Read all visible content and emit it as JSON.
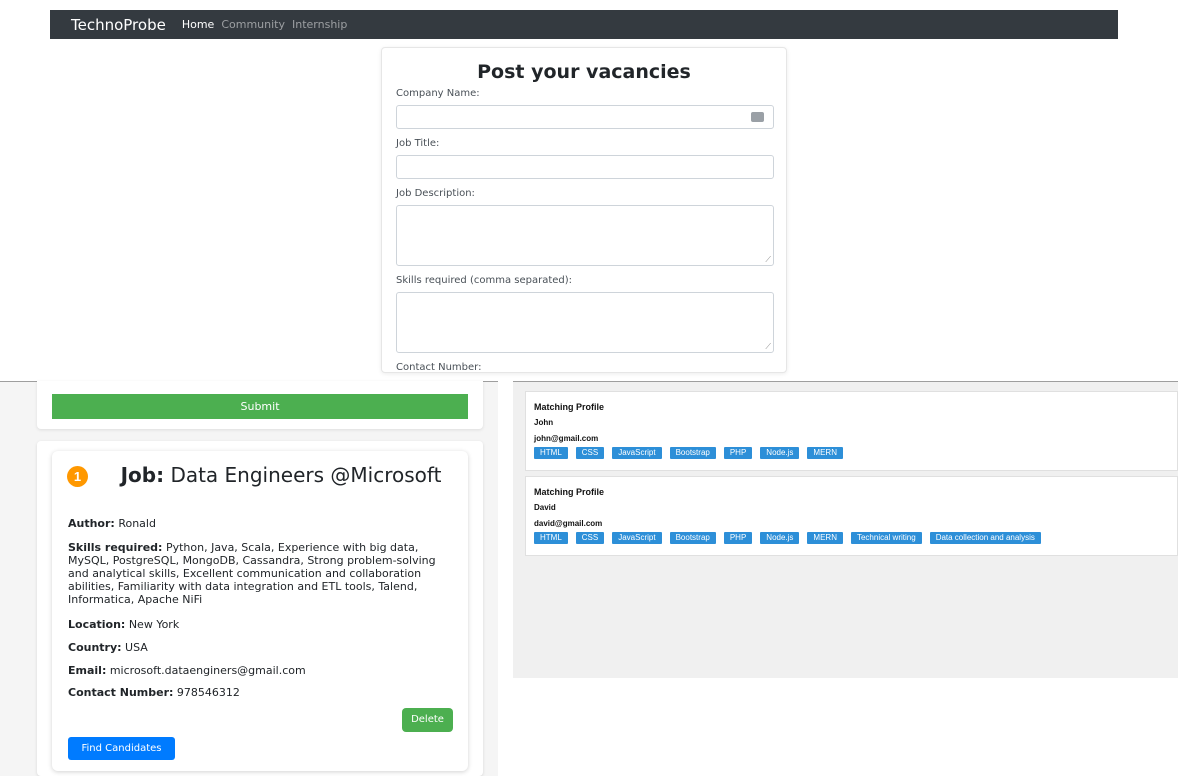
{
  "navbar": {
    "brand": "TechnoProbe",
    "links": [
      "Home",
      "Community",
      "Internship"
    ]
  },
  "form": {
    "title": "Post your vacancies",
    "labels": {
      "company": "Company Name:",
      "job_title": "Job Title:",
      "description": "Job Description:",
      "skills": "Skills required (comma separated):",
      "contact": "Contact Number:"
    },
    "submit_label": "Submit"
  },
  "job": {
    "index": "1",
    "title_prefix": "Job:",
    "title": "Data Engineers @Microsoft",
    "author_label": "Author:",
    "author": "Ronald",
    "skills_label": "Skills required:",
    "skills": "Python, Java, Scala, Experience with big data, MySQL, PostgreSQL, MongoDB, Cassandra, Strong problem-solving and analytical skills, Excellent communication and collaboration abilities, Familiarity with data integration and ETL tools, Talend, Informatica, Apache NiFi",
    "location_label": "Location:",
    "location": "New York",
    "country_label": "Country:",
    "country": "USA",
    "email_label": "Email:",
    "email": "microsoft.dataenginers@gmail.com",
    "contact_label": "Contact Number:",
    "contact": "978546312",
    "delete_label": "Delete",
    "find_label": "Find Candidates"
  },
  "profiles": [
    {
      "heading": "Matching Profile",
      "name": "John",
      "email": "john@gmail.com",
      "skills": [
        "HTML",
        "CSS",
        "JavaScript",
        "Bootstrap",
        "PHP",
        "Node.js",
        "MERN"
      ]
    },
    {
      "heading": "Matching Profile",
      "name": "David",
      "email": "david@gmail.com",
      "skills": [
        "HTML",
        "CSS",
        "JavaScript",
        "Bootstrap",
        "PHP",
        "Node.js",
        "MERN",
        "Technical writing",
        "Data collection and analysis"
      ]
    }
  ],
  "colors": {
    "navbar": "#343a40",
    "submit": "#4caf50",
    "find": "#007bff",
    "badge": "#ff9800",
    "skill_tag": "#2d8fd8"
  }
}
